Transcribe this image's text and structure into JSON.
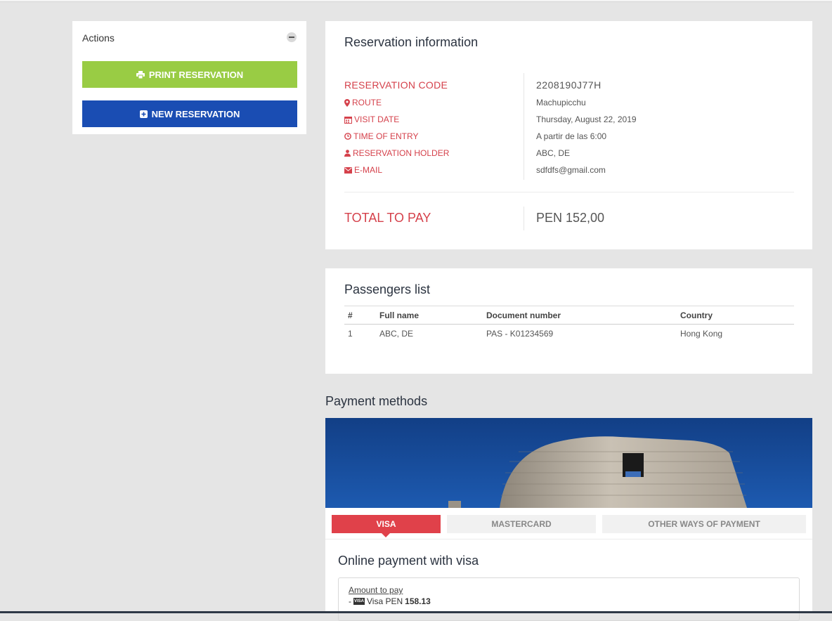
{
  "actions": {
    "title": "Actions",
    "print_label": "PRINT RESERVATION",
    "new_label": "NEW RESERVATION"
  },
  "reservation": {
    "title": "Reservation information",
    "code_label": "RESERVATION CODE",
    "code_value": "2208190J77H",
    "route_label": "ROUTE",
    "route_value": "Machupicchu",
    "visit_date_label": "VISIT DATE",
    "visit_date_value": "Thursday, August 22, 2019",
    "time_label": "TIME OF ENTRY",
    "time_value": "A partir de las 6:00",
    "holder_label": "RESERVATION HOLDER",
    "holder_value": "ABC, DE",
    "email_label": "E-MAIL",
    "email_value": "sdfdfs@gmail.com",
    "total_label": "TOTAL TO PAY",
    "total_value": "PEN 152,00"
  },
  "passengers": {
    "title": "Passengers list",
    "columns": [
      "#",
      "Full name",
      "Document number",
      "Country"
    ],
    "rows": [
      [
        "1",
        "ABC, DE",
        "PAS - K01234569",
        "Hong Kong"
      ]
    ]
  },
  "payment": {
    "title": "Payment methods",
    "tabs": [
      "VISA",
      "MASTERCARD",
      "OTHER WAYS OF PAYMENT"
    ],
    "online_title": "Online payment with visa",
    "amount_link": "Amount to pay",
    "amount_prefix": "-",
    "amount_method": "Visa PEN",
    "amount_value": "158.13",
    "badge_text": "VISA"
  },
  "colors": {
    "accent_red": "#e0414a",
    "label_red": "#d5414b",
    "print_green": "#99cc44",
    "new_blue": "#1a4db3"
  },
  "icons": [
    "minus-circle-icon",
    "printer-icon",
    "plus-square-icon",
    "map-marker-icon",
    "calendar-icon",
    "clock-icon",
    "user-icon",
    "envelope-icon"
  ]
}
